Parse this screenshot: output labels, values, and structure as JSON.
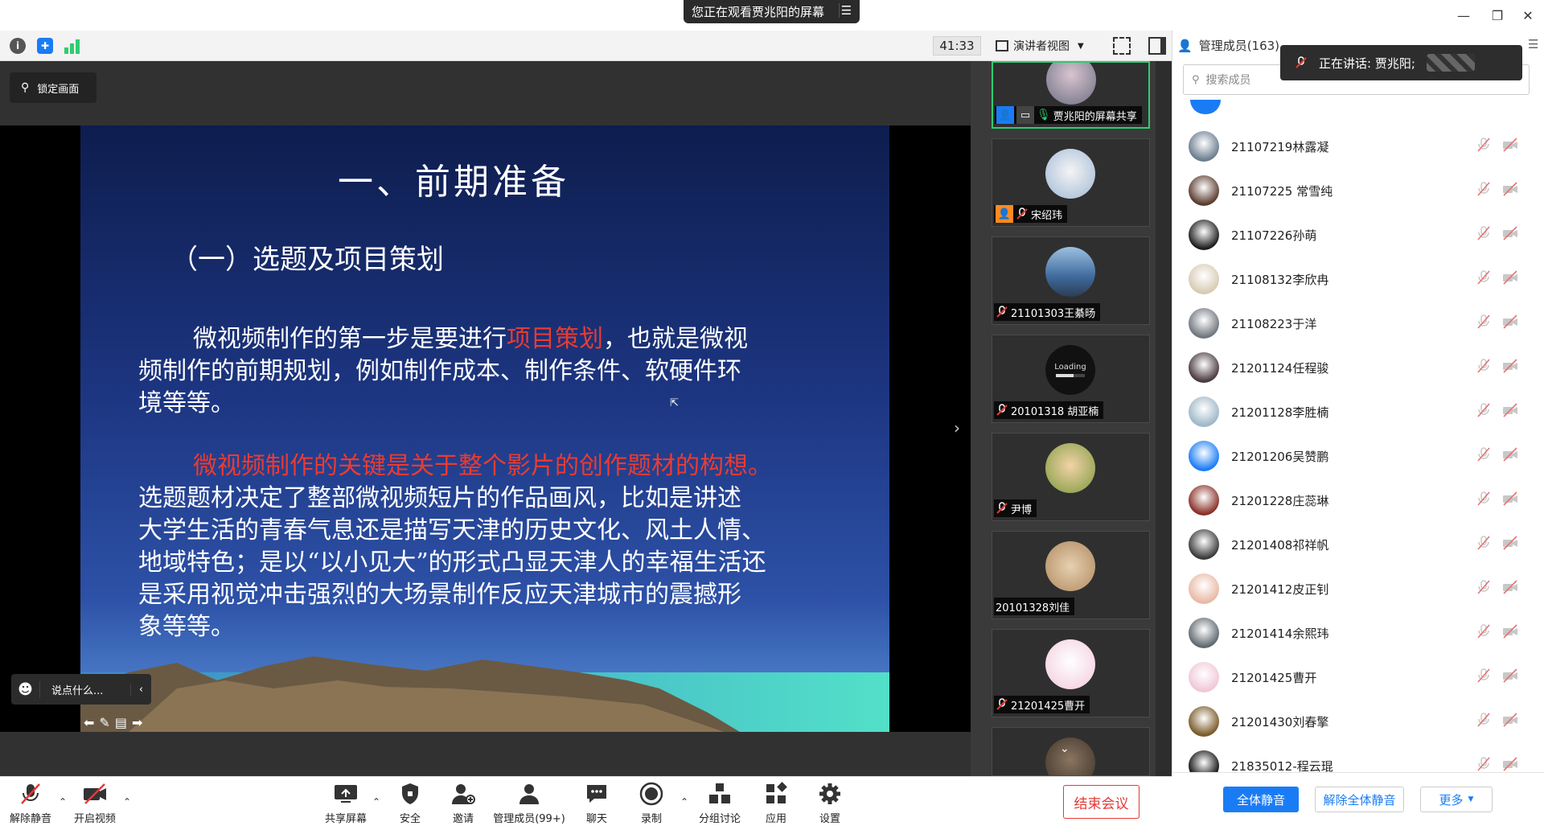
{
  "window": {
    "share_banner": "您正在观看贾兆阳的屏幕",
    "minimize": "—",
    "restore": "❐",
    "close": "✕"
  },
  "toolbar": {
    "timer": "41:33",
    "view_mode": "演讲者视图"
  },
  "stage": {
    "lock_label": "锁定画面",
    "chat_placeholder": "说点什么..."
  },
  "slide": {
    "title": "一、前期准备",
    "subtitle": "（一）选题及项目策划",
    "p1_a": "微视频制作的第一步是要进行",
    "p1_red": "项目策划",
    "p1_b": "，也就是微视",
    "p1_line2": "频制作的前期规划，例如制作成本、制作条件、软硬件环",
    "p1_line3": "境等等。",
    "p2_red": "微视频制作的关键是关于整个影片的创作题材的构想。",
    "p2_line2": "选题题材决定了整部微视频短片的作品画风，比如是讲述",
    "p2_line3": "大学生活的青春气息还是描写天津的历史文化、风土人情、",
    "p2_line4": "地域特色；是以“以小见大”的形式凸显天津人的幸福生活还",
    "p2_line5": "是采用视觉冲击强烈的大场景制作反应天津城市的震撼形",
    "p2_line6": "象等等。"
  },
  "strip": {
    "tiles": [
      {
        "label": "贾兆阳的屏幕共享"
      },
      {
        "label": "宋绍玮"
      },
      {
        "label": "21101303王綦旸"
      },
      {
        "label": "20101318 胡亚楠",
        "loading": "Loading"
      },
      {
        "label": "尹博"
      },
      {
        "label": "20101328刘佳"
      },
      {
        "label": "21201425曹开"
      }
    ]
  },
  "panel": {
    "title": "管理成员(163)",
    "search_placeholder": "搜索成员",
    "speaking": "正在讲话: 贾兆阳;",
    "members": [
      {
        "name": "21107219林露凝",
        "color": "#6b7d8f"
      },
      {
        "name": "21107225 常雪纯",
        "color": "#5a3b2e"
      },
      {
        "name": "21107226孙萌",
        "color": "#1d1d1d"
      },
      {
        "name": "21108132李欣冉",
        "color": "#d8cbb5"
      },
      {
        "name": "21108223于洋",
        "color": "#70767e"
      },
      {
        "name": "21201124任程骏",
        "color": "#4a3a3f"
      },
      {
        "name": "21201128李胜楠",
        "color": "#9fb7c8"
      },
      {
        "name": "21201206吴赞鹏",
        "color": "#1a7cf5"
      },
      {
        "name": "21201228庄蕊琳",
        "color": "#8a3028"
      },
      {
        "name": "21201408祁祥帆",
        "color": "#3a3a3a"
      },
      {
        "name": "21201412皮正钊",
        "color": "#e8b9a5"
      },
      {
        "name": "21201414余熙玮",
        "color": "#5f6970"
      },
      {
        "name": "21201425曹开",
        "color": "#f0c8d8"
      },
      {
        "name": "21201430刘春擎",
        "color": "#7a5a2a"
      },
      {
        "name": "21835012-程云琨",
        "color": "#111111"
      }
    ],
    "mute_all": "全体静音",
    "unmute_all": "解除全体静音",
    "more": "更多"
  },
  "controls": {
    "unmute": "解除静音",
    "start_video": "开启视频",
    "share": "共享屏幕",
    "security": "安全",
    "invite": "邀请",
    "manage": "管理成员(99+)",
    "chat": "聊天",
    "record": "录制",
    "breakout": "分组讨论",
    "apps": "应用",
    "settings": "设置",
    "end": "结束会议"
  }
}
